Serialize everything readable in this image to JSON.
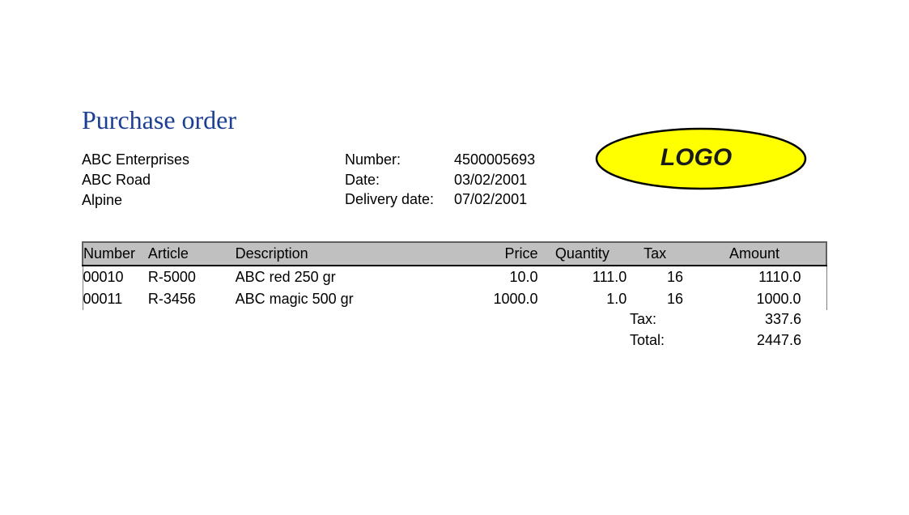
{
  "document": {
    "title": "Purchase order"
  },
  "company": {
    "name": "ABC Enterprises",
    "street": "ABC Road",
    "city": "Alpine"
  },
  "order": {
    "number_label": "Number:",
    "number": "4500005693",
    "date_label": "Date:",
    "date": "03/02/2001",
    "delivery_label": "Delivery date:",
    "delivery_date": "07/02/2001"
  },
  "logo": {
    "text": "LOGO",
    "fill_color": "#ffff00"
  },
  "table": {
    "headers": [
      "Number",
      "Article",
      "Description",
      "Price",
      "Quantity",
      "Tax",
      "Amount"
    ],
    "rows": [
      [
        "00010",
        "R-5000",
        "ABC red 250 gr",
        "10.0",
        "111.0",
        "16",
        "1110.0"
      ],
      [
        "00011",
        "R-3456",
        "ABC magic 500 gr",
        "1000.0",
        "1.0",
        "16",
        "1000.0"
      ]
    ]
  },
  "totals": {
    "tax_label": "Tax:",
    "tax_value": "337.6",
    "total_label": "Total:",
    "total_value": "2447.6"
  }
}
